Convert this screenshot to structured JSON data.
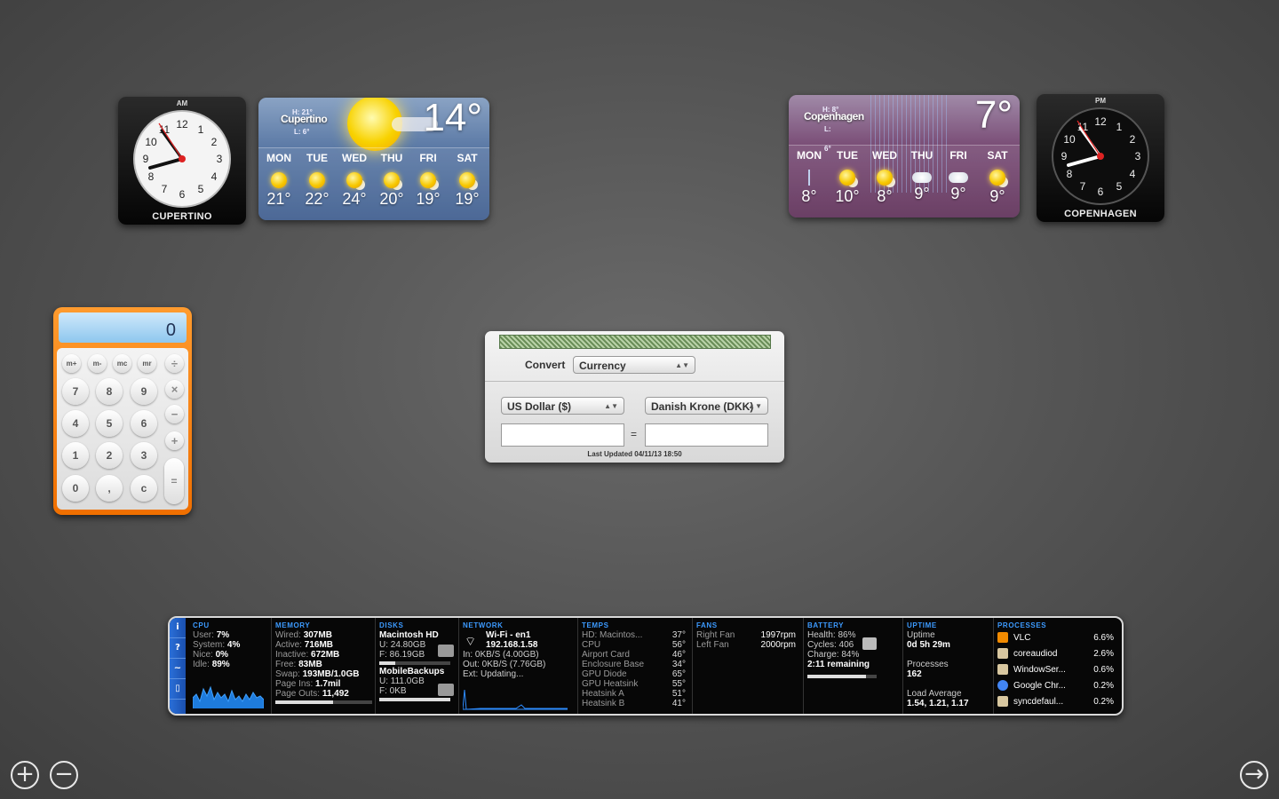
{
  "clock_left": {
    "ampm": "AM",
    "city": "CUPERTINO",
    "numbers": [
      "12",
      "1",
      "2",
      "3",
      "4",
      "5",
      "6",
      "7",
      "8",
      "9",
      "10",
      "11"
    ]
  },
  "clock_right": {
    "ampm": "PM",
    "city": "COPENHAGEN",
    "numbers": [
      "12",
      "1",
      "2",
      "3",
      "4",
      "5",
      "6",
      "7",
      "8",
      "9",
      "10",
      "11"
    ]
  },
  "weather_left": {
    "city": "Cupertino",
    "high": "H: 21°",
    "low": "L: 6°",
    "temp": "14°",
    "days": [
      {
        "name": "MON",
        "temp": "21°",
        "icon": "sun-icon"
      },
      {
        "name": "TUE",
        "temp": "22°",
        "icon": "sun-icon"
      },
      {
        "name": "WED",
        "temp": "24°",
        "icon": "sun-cloud-icon"
      },
      {
        "name": "THU",
        "temp": "20°",
        "icon": "sun-cloud-icon"
      },
      {
        "name": "FRI",
        "temp": "19°",
        "icon": "sun-cloud-icon"
      },
      {
        "name": "SAT",
        "temp": "19°",
        "icon": "sun-cloud-icon"
      }
    ]
  },
  "weather_right": {
    "city": "Copenhagen",
    "high": "H: 8°",
    "low": "L: 6°",
    "temp": "7°",
    "days": [
      {
        "name": "MON",
        "temp": "8°",
        "icon": "rain-icon"
      },
      {
        "name": "TUE",
        "temp": "10°",
        "icon": "sun-cloud-icon"
      },
      {
        "name": "WED",
        "temp": "8°",
        "icon": "sun-cloud-icon"
      },
      {
        "name": "THU",
        "temp": "9°",
        "icon": "snow-icon"
      },
      {
        "name": "FRI",
        "temp": "9°",
        "icon": "snow-icon"
      },
      {
        "name": "SAT",
        "temp": "9°",
        "icon": "sun-cloud-icon"
      }
    ]
  },
  "calculator": {
    "display": "0",
    "memory_keys": [
      "m+",
      "m-",
      "mc",
      "mr"
    ],
    "digits": {
      "k7": "7",
      "k8": "8",
      "k9": "9",
      "k4": "4",
      "k5": "5",
      "k6": "6",
      "k1": "1",
      "k2": "2",
      "k3": "3",
      "k0": "0",
      "dot": ",",
      "clear": "c"
    },
    "ops": {
      "div": "÷",
      "mul": "×",
      "sub": "−",
      "add": "+",
      "eq": "="
    }
  },
  "converter": {
    "convert_label": "Convert",
    "type": "Currency",
    "from": "US Dollar ($)",
    "to": "Danish Krone (DKK)",
    "equals": "=",
    "updated": "Last Updated 04/11/13 18:50"
  },
  "istat": {
    "side": [
      "i",
      "?",
      "~",
      "▯"
    ],
    "cpu": {
      "h": "CPU",
      "rows": [
        [
          "User:",
          "7%"
        ],
        [
          "System:",
          "4%"
        ],
        [
          "Nice:",
          "0%"
        ],
        [
          "Idle:",
          "89%"
        ]
      ]
    },
    "memory": {
      "h": "MEMORY",
      "rows": [
        [
          "Wired:",
          "307MB"
        ],
        [
          "Active:",
          "716MB"
        ],
        [
          "Inactive:",
          "672MB"
        ],
        [
          "Free:",
          "83MB"
        ],
        [
          "Swap:",
          "193MB/1.0GB"
        ],
        [
          "Page Ins:",
          "1.7mil"
        ],
        [
          "Page Outs:",
          "11,492"
        ]
      ],
      "bar": 0.6
    },
    "disks": {
      "h": "DISKS",
      "d1": "Macintosh HD",
      "d1u": "U: 24.80GB",
      "d1f": "F: 86.19GB",
      "d1bar": 0.22,
      "d2": "MobileBackups",
      "d2u": "U: 111.0GB",
      "d2f": "F: 0KB",
      "d2bar": 1.0
    },
    "network": {
      "h": "NETWORK",
      "if": "Wi-Fi - en1",
      "ip": "192.168.1.58",
      "in": "In: 0KB/S (4.00GB)",
      "out": "Out: 0KB/S (7.76GB)",
      "ext": "Ext: Updating..."
    },
    "temps": {
      "h": "TEMPS",
      "rows": [
        [
          "HD: Macintos...",
          "37°"
        ],
        [
          "CPU",
          "56°"
        ],
        [
          "Airport Card",
          "46°"
        ],
        [
          "Enclosure Base",
          "34°"
        ],
        [
          "GPU Diode",
          "65°"
        ],
        [
          "GPU Heatsink",
          "55°"
        ],
        [
          "Heatsink A",
          "51°"
        ],
        [
          "Heatsink B",
          "41°"
        ]
      ]
    },
    "fans": {
      "h": "FANS",
      "rows": [
        [
          "Right Fan",
          "1997rpm"
        ],
        [
          "Left Fan",
          "2000rpm"
        ]
      ]
    },
    "battery": {
      "h": "BATTERY",
      "health": "Health: 86%",
      "cycles": "Cycles: 406",
      "charge": "Charge: 84%",
      "remaining": "2:11 remaining",
      "level": 0.84
    },
    "uptime": {
      "h": "UPTIME",
      "label": "Uptime",
      "value": "0d 5h 29m",
      "proc_label": "Processes",
      "proc_value": "162",
      "load_label": "Load Average",
      "load_value": "1.54, 1.21, 1.17"
    },
    "processes": {
      "h": "PROCESSES",
      "items": [
        {
          "name": "VLC",
          "value": "6.6%",
          "icon": "vlc-icon",
          "color": "#f08a00"
        },
        {
          "name": "coreaudiod",
          "value": "2.6%",
          "icon": "app-icon",
          "color": "#d8c7a0"
        },
        {
          "name": "WindowSer...",
          "value": "0.6%",
          "icon": "app-icon",
          "color": "#d8c7a0"
        },
        {
          "name": "Google Chr...",
          "value": "0.2%",
          "icon": "chrome-icon",
          "color": "#4285f4"
        },
        {
          "name": "syncdefaul...",
          "value": "0.2%",
          "icon": "app-icon",
          "color": "#d8c7a0"
        }
      ]
    }
  },
  "controls": {
    "add": "+",
    "remove": "−",
    "next": "→"
  }
}
